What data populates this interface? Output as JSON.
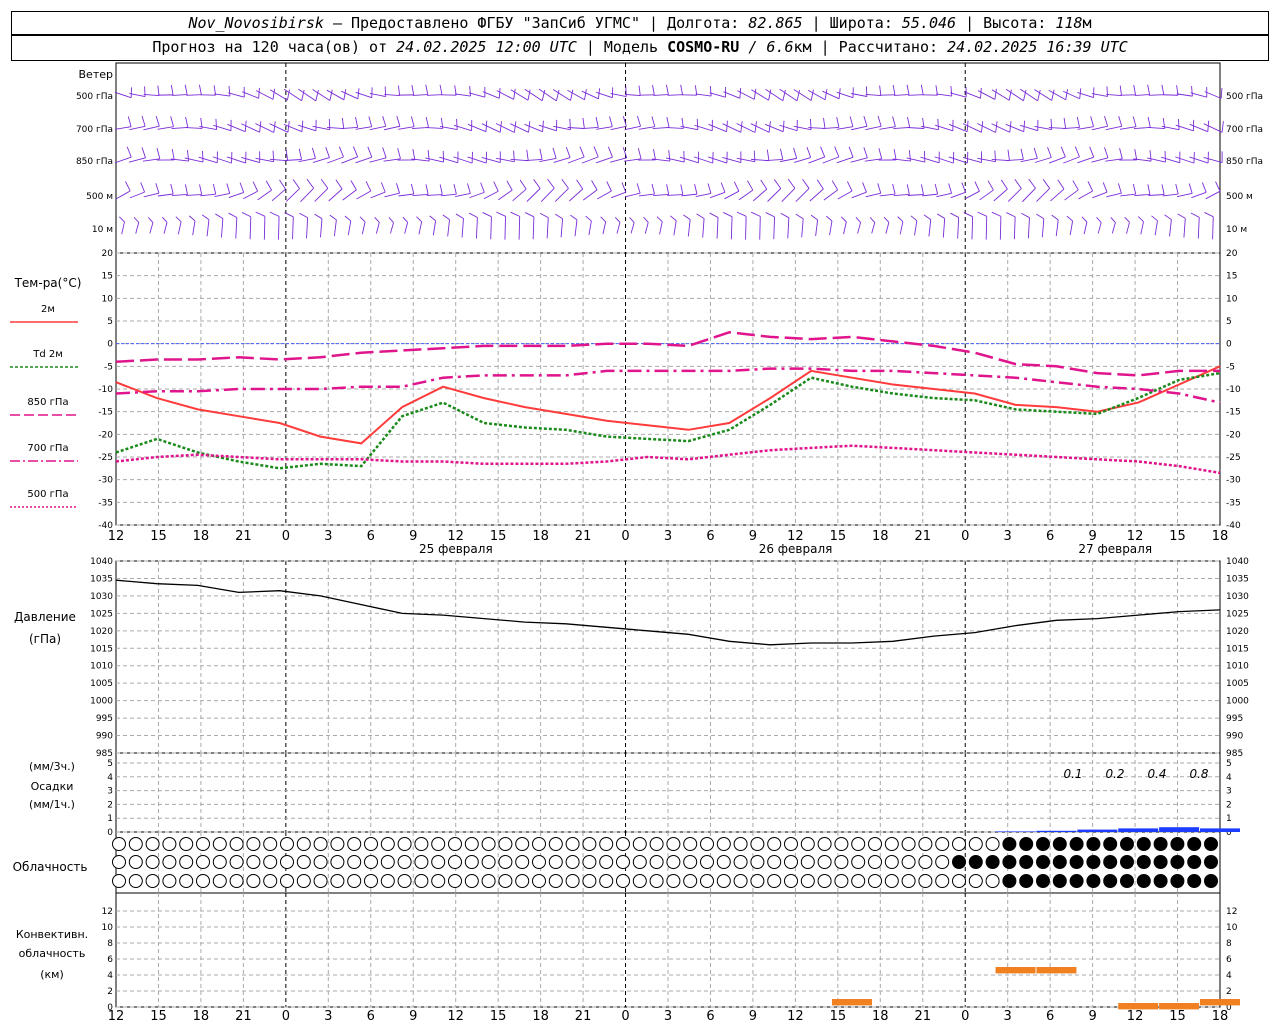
{
  "header": {
    "station": "Nov_Novosibirsk",
    "provider": "– Предоставлено ФГБУ \"ЗапСиб УГМС\"",
    "lon_label": "Долгота:",
    "lon": "82.865",
    "lat_label": "Широта:",
    "lat": "55.046",
    "alt_label": "Высота:",
    "alt": "118",
    "alt_unit": "м",
    "forecast_label": "Прогноз на 120 часа(ов) от",
    "init_time": "24.02.2025 12:00 UTC",
    "model_label": "| Модель",
    "model": "COSMO-RU",
    "model_res": "/ 6.6",
    "model_res_unit": "км",
    "calc_label": "| Рассчитано:",
    "calc_time": "24.02.2025 16:39 UTC"
  },
  "wind_panel": {
    "label": "Ветер",
    "levels": [
      "500 гПа",
      "700 гПа",
      "850 гПа",
      "500 м",
      "10  м"
    ]
  },
  "time_axis": {
    "hour_labels": [
      "12",
      "15",
      "18",
      "21",
      "0",
      "3",
      "6",
      "9",
      "12",
      "15",
      "18",
      "21",
      "0",
      "3",
      "6",
      "9",
      "12",
      "15",
      "18",
      "21",
      "0",
      "3",
      "6",
      "9",
      "12",
      "15",
      "18"
    ],
    "day_labels": [
      "25 февраля",
      "26 февраля",
      "27 февраля"
    ]
  },
  "temp_panel": {
    "title": "Тем-ра(°C)",
    "legend": [
      {
        "label": "2м",
        "color": "#ff3b3b",
        "style": "solid"
      },
      {
        "label": "Td  2м",
        "color": "#1a8a1a",
        "style": "dotted"
      },
      {
        "label": "850 гПа",
        "color": "#e0148c",
        "style": "dashed"
      },
      {
        "label": "700 гПа",
        "color": "#e0148c",
        "style": "dashdot"
      },
      {
        "label": "500 гПа",
        "color": "#e0148c",
        "style": "fine-dotted"
      }
    ],
    "y_ticks": [
      "20",
      "15",
      "10",
      "5",
      "0",
      "-5",
      "-10",
      "-15",
      "-20",
      "-25",
      "-30",
      "-35",
      "-40"
    ]
  },
  "pressure_panel": {
    "title": "Давление",
    "unit": "(гПа)",
    "y_ticks": [
      "1040",
      "1035",
      "1030",
      "1025",
      "1020",
      "1015",
      "1010",
      "1005",
      "1000",
      "995",
      "990",
      "985"
    ]
  },
  "precip_panel": {
    "unit_top": "(мм/3ч.)",
    "title": "Осадки",
    "unit_bottom": "(мм/1ч.)",
    "y_ticks": [
      "5",
      "4",
      "3",
      "2",
      "1",
      "0"
    ],
    "amounts": [
      "0.1",
      "0.2",
      "0.4",
      "0.8"
    ]
  },
  "cloud_panel": {
    "title": "Облачность"
  },
  "conv_panel": {
    "title1": "Конвективн.",
    "title2": "облачность",
    "unit": "(км)",
    "y_ticks": [
      "12",
      "10",
      "8",
      "6",
      "4",
      "2",
      "0"
    ]
  },
  "chart_data": {
    "type": "line",
    "x_hours": [
      0,
      3,
      6,
      9,
      12,
      15,
      18,
      21,
      24,
      27,
      30,
      33,
      36,
      39,
      42,
      45,
      48,
      51,
      54,
      57,
      60,
      63,
      66,
      69,
      72,
      75,
      78
    ],
    "series": [
      {
        "name": "2м",
        "values": [
          -8.5,
          -12,
          -14.5,
          -16,
          -17.5,
          -20.5,
          -22,
          -14,
          -9.5,
          -12,
          -14,
          -15.5,
          -17,
          -18,
          -19,
          -17.5,
          -12,
          -6,
          -7.5,
          -9,
          -10,
          -11,
          -13.5,
          -14,
          -15,
          -13,
          -9,
          -5
        ]
      },
      {
        "name": "Td  2м",
        "values": [
          -24,
          -21,
          -24,
          -26,
          -27.5,
          -26.5,
          -27,
          -16,
          -13,
          -17.5,
          -18.5,
          -19,
          -20.5,
          -21,
          -21.5,
          -19,
          -13.5,
          -7.5,
          -9.5,
          -11,
          -12,
          -12.5,
          -14.5,
          -15,
          -15.5,
          -12,
          -8,
          -6.5
        ]
      },
      {
        "name": "850 гПа",
        "values": [
          -4,
          -3.5,
          -3.5,
          -3,
          -3.5,
          -3,
          -2,
          -1.5,
          -1,
          -0.5,
          -0.5,
          -0.5,
          0,
          0,
          -0.5,
          2.5,
          1.5,
          1,
          1.5,
          0.5,
          -0.5,
          -2,
          -4.5,
          -5,
          -6.5,
          -7,
          -6,
          -6
        ]
      },
      {
        "name": "700 гПа",
        "values": [
          -11,
          -10.5,
          -10.5,
          -10,
          -10,
          -10,
          -9.5,
          -9.5,
          -7.5,
          -7,
          -7,
          -7,
          -6,
          -6,
          -6,
          -6,
          -5.5,
          -5.5,
          -6,
          -6,
          -6.5,
          -7,
          -7.5,
          -8.5,
          -9.5,
          -10,
          -11,
          -13
        ]
      },
      {
        "name": "500 гПа",
        "values": [
          -26,
          -25,
          -24.5,
          -25,
          -25.5,
          -25.5,
          -25.5,
          -26,
          -26,
          -26.5,
          -26.5,
          -26.5,
          -26,
          -25,
          -25.5,
          -24.5,
          -23.5,
          -23,
          -22.5,
          -23,
          -23.5,
          -24,
          -24.5,
          -25,
          -25.5,
          -26,
          -27,
          -28.5
        ]
      }
    ],
    "pressure": [
      1034.5,
      1033.5,
      1033,
      1031,
      1031.5,
      1030,
      1027.5,
      1025,
      1024.5,
      1023.5,
      1022.5,
      1022,
      1021,
      1020,
      1019,
      1017,
      1016,
      1016.5,
      1016.5,
      1017,
      1018.5,
      1019.5,
      1021.5,
      1023,
      1023.5,
      1024.5,
      1025.5,
      1026
    ],
    "precip_mm": [
      0,
      0,
      0,
      0,
      0,
      0,
      0,
      0,
      0,
      0,
      0,
      0,
      0,
      0,
      0,
      0,
      0,
      0,
      0,
      0,
      0,
      0,
      0.1,
      0.2,
      0.4,
      0.6,
      0.8,
      0.6
    ],
    "conv_top_km": [
      0,
      0,
      0,
      0,
      0,
      0,
      0,
      0,
      0,
      0,
      0,
      0,
      0,
      0,
      0,
      0,
      0,
      0,
      1,
      0,
      0,
      0,
      5,
      5,
      0,
      0.5,
      0.5,
      1
    ],
    "ylim_temp": [
      -40,
      20
    ],
    "ylim_pressure": [
      985,
      1040
    ]
  }
}
